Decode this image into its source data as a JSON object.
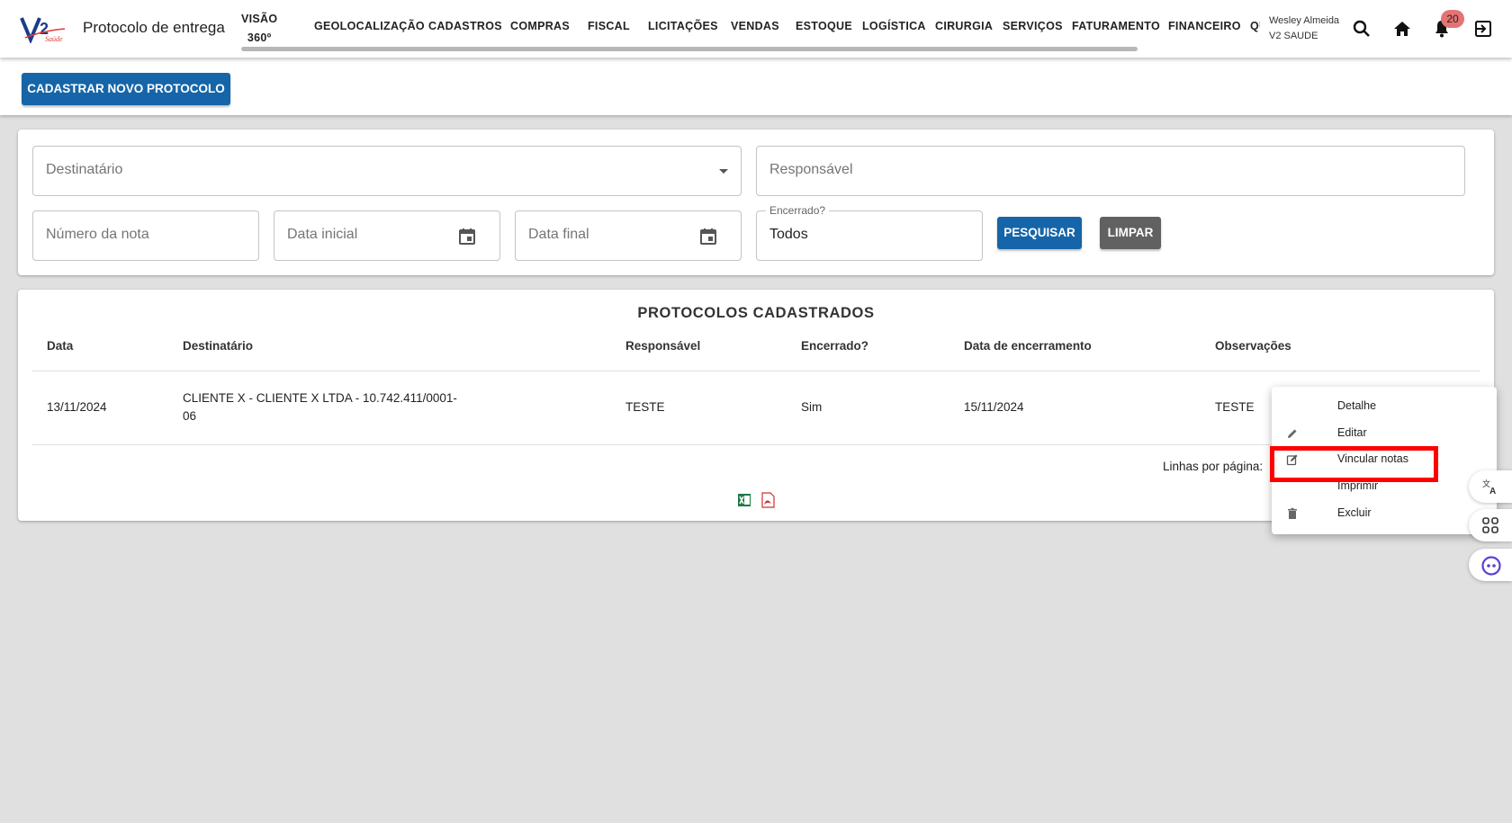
{
  "header": {
    "page_title": "Protocolo de entrega",
    "nav": [
      {
        "line1": "VISÃO",
        "line2": "360º"
      },
      {
        "label": "GEOLOCALIZAÇÃO"
      },
      {
        "label": "CADASTROS"
      },
      {
        "label": "COMPRAS"
      },
      {
        "label": "FISCAL"
      },
      {
        "label": "LICITAÇÕES"
      },
      {
        "label": "VENDAS"
      },
      {
        "label": "ESTOQUE"
      },
      {
        "label": "LOGÍSTICA"
      },
      {
        "label": "CIRURGIA"
      },
      {
        "label": "SERVIÇOS"
      },
      {
        "label": "FATURAMENTO"
      },
      {
        "label": "FINANCEIRO"
      },
      {
        "label": "QU"
      }
    ],
    "user_name": "Wesley Almeida",
    "user_company": "V2 SAUDE",
    "notification_count": "20"
  },
  "actions": {
    "new_button": "CADASTRAR NOVO PROTOCOLO"
  },
  "filters": {
    "destinatario_placeholder": "Destinatário",
    "responsavel_placeholder": "Responsável",
    "numero_nota_placeholder": "Número da nota",
    "data_inicial_placeholder": "Data inicial",
    "data_final_placeholder": "Data final",
    "encerrado_label": "Encerrado?",
    "encerrado_value": "Todos",
    "search_button": "PESQUISAR",
    "clear_button": "LIMPAR"
  },
  "table": {
    "title": "PROTOCOLOS CADASTRADOS",
    "columns": [
      "Data",
      "Destinatário",
      "Responsável",
      "Encerrado?",
      "Data de encerramento",
      "Observações"
    ],
    "rows": [
      {
        "data": "13/11/2024",
        "destinatario_line1": "CLIENTE X - CLIENTE X LTDA - 10.742.411/0001-",
        "destinatario_line2": "06",
        "responsavel": "TESTE",
        "encerrado": "Sim",
        "data_encerramento": "15/11/2024",
        "observacoes": "TESTE"
      }
    ],
    "rows_per_page_label": "Linhas por página:"
  },
  "context_menu": {
    "items": [
      {
        "label": "Detalhe",
        "icon": ""
      },
      {
        "label": "Editar",
        "icon": "pencil-icon"
      },
      {
        "label": "Vincular notas",
        "icon": "edit-link-icon"
      },
      {
        "label": "Imprimir",
        "icon": ""
      },
      {
        "label": "Excluir",
        "icon": "trash-icon"
      }
    ]
  },
  "colors": {
    "primary": "#1565a8",
    "secondary": "#616161",
    "highlight": "#ff0000",
    "badge": "#e57373"
  }
}
